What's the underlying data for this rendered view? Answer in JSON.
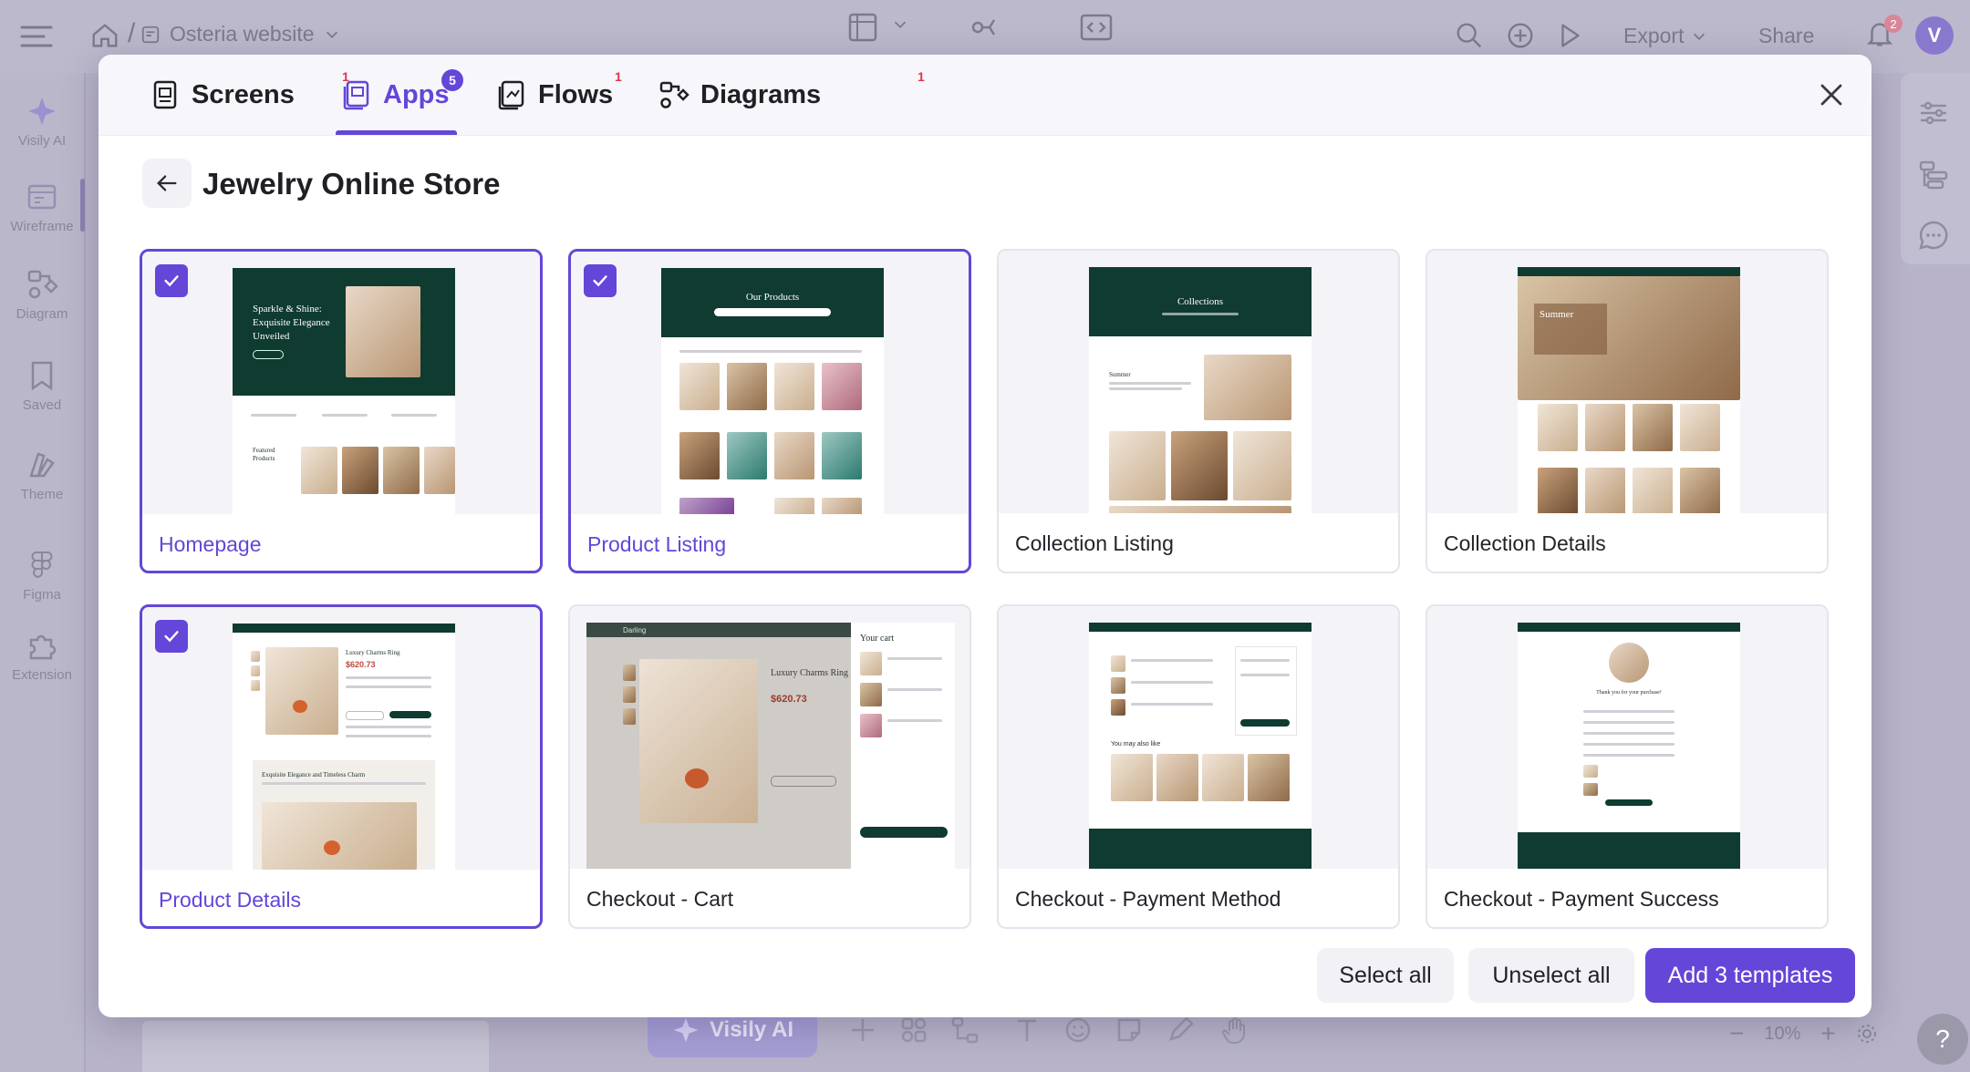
{
  "app": {
    "project_name": "Osteria website",
    "export_label": "Export",
    "share_label": "Share",
    "notification_count": "2",
    "avatar_letter": "V",
    "sidebar": [
      {
        "label": "Visily AI",
        "icon": "sparkle-icon"
      },
      {
        "label": "Wireframe",
        "icon": "wireframe-icon"
      },
      {
        "label": "Diagram",
        "icon": "diagram-icon"
      },
      {
        "label": "Saved",
        "icon": "saved-icon"
      },
      {
        "label": "Theme",
        "icon": "theme-icon"
      },
      {
        "label": "Figma",
        "icon": "figma-icon"
      },
      {
        "label": "Extension",
        "icon": "extension-icon"
      }
    ],
    "bottom": {
      "visily_ai_label": "Visily AI",
      "zoom_label": "10%",
      "help_label": "?"
    }
  },
  "modal": {
    "tabs": [
      {
        "label": "Screens",
        "badge": "1",
        "active": false
      },
      {
        "label": "Apps",
        "badge": "5",
        "active": true
      },
      {
        "label": "Flows",
        "badge": "1",
        "active": false
      },
      {
        "label": "Diagrams",
        "badge": "1",
        "active": false
      }
    ],
    "title": "Jewelry Online Store",
    "templates": [
      {
        "label": "Homepage",
        "selected": true
      },
      {
        "label": "Product Listing",
        "selected": true
      },
      {
        "label": "Collection Listing",
        "selected": false
      },
      {
        "label": "Collection Details",
        "selected": false
      },
      {
        "label": "Product Details",
        "selected": true
      },
      {
        "label": "Checkout - Cart",
        "selected": false
      },
      {
        "label": "Checkout - Payment Method",
        "selected": false
      },
      {
        "label": "Checkout - Payment Success",
        "selected": false
      }
    ],
    "thumb_text": {
      "home_hero": "Sparkle & Shine: Exquisite Elegance Unveiled",
      "featured": "Featured Products",
      "our_products": "Our Products",
      "collections": "Collections",
      "summer": "Summer",
      "ring_name": "Luxury Charms Ring",
      "price": "$620.73",
      "elegance": "Exquisite Elegance and Timeless Charm",
      "brand": "Darling",
      "your_cart": "Your cart",
      "you_may_like": "You may also like",
      "thanks": "Thank you for your purchase!"
    },
    "actions": {
      "select_all": "Select all",
      "unselect_all": "Unselect all",
      "add_templates": "Add 3 templates"
    }
  },
  "colors": {
    "accent": "#6446d8",
    "badge_red": "#e0344e",
    "brand_green": "#0f3b31"
  }
}
